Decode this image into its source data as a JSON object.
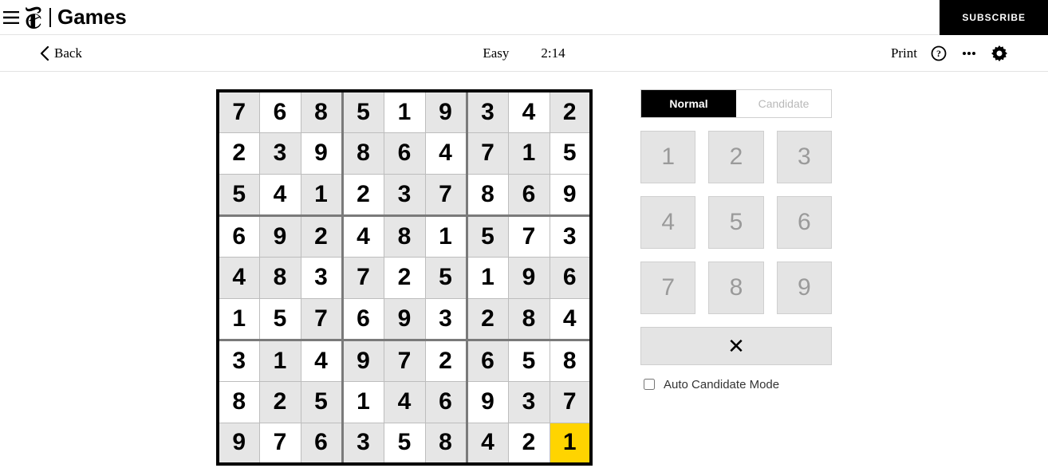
{
  "header": {
    "brand_separator": "|",
    "brand_games": "Games",
    "subscribe": "SUBSCRIBE"
  },
  "subbar": {
    "back": "Back",
    "difficulty": "Easy",
    "timer": "2:14",
    "print": "Print"
  },
  "board": {
    "cells": [
      [
        {
          "v": "7",
          "s": 1
        },
        {
          "v": "6"
        },
        {
          "v": "8",
          "s": 1
        },
        {
          "v": "5",
          "s": 1
        },
        {
          "v": "1"
        },
        {
          "v": "9",
          "s": 1
        },
        {
          "v": "3",
          "s": 1
        },
        {
          "v": "4"
        },
        {
          "v": "2",
          "s": 1
        }
      ],
      [
        {
          "v": "2"
        },
        {
          "v": "3",
          "s": 1
        },
        {
          "v": "9"
        },
        {
          "v": "8",
          "s": 1
        },
        {
          "v": "6",
          "s": 1
        },
        {
          "v": "4"
        },
        {
          "v": "7",
          "s": 1
        },
        {
          "v": "1",
          "s": 1
        },
        {
          "v": "5"
        }
      ],
      [
        {
          "v": "5",
          "s": 1
        },
        {
          "v": "4"
        },
        {
          "v": "1",
          "s": 1
        },
        {
          "v": "2"
        },
        {
          "v": "3",
          "s": 1
        },
        {
          "v": "7",
          "s": 1
        },
        {
          "v": "8"
        },
        {
          "v": "6",
          "s": 1
        },
        {
          "v": "9"
        }
      ],
      [
        {
          "v": "6"
        },
        {
          "v": "9",
          "s": 1
        },
        {
          "v": "2",
          "s": 1
        },
        {
          "v": "4"
        },
        {
          "v": "8",
          "s": 1
        },
        {
          "v": "1"
        },
        {
          "v": "5",
          "s": 1
        },
        {
          "v": "7"
        },
        {
          "v": "3"
        }
      ],
      [
        {
          "v": "4",
          "s": 1
        },
        {
          "v": "8",
          "s": 1
        },
        {
          "v": "3"
        },
        {
          "v": "7",
          "s": 1
        },
        {
          "v": "2"
        },
        {
          "v": "5",
          "s": 1
        },
        {
          "v": "1"
        },
        {
          "v": "9",
          "s": 1
        },
        {
          "v": "6",
          "s": 1
        }
      ],
      [
        {
          "v": "1"
        },
        {
          "v": "5"
        },
        {
          "v": "7",
          "s": 1
        },
        {
          "v": "6"
        },
        {
          "v": "9",
          "s": 1
        },
        {
          "v": "3"
        },
        {
          "v": "2",
          "s": 1
        },
        {
          "v": "8",
          "s": 1
        },
        {
          "v": "4"
        }
      ],
      [
        {
          "v": "3"
        },
        {
          "v": "1",
          "s": 1
        },
        {
          "v": "4"
        },
        {
          "v": "9",
          "s": 1
        },
        {
          "v": "7",
          "s": 1
        },
        {
          "v": "2"
        },
        {
          "v": "6",
          "s": 1
        },
        {
          "v": "5"
        },
        {
          "v": "8"
        }
      ],
      [
        {
          "v": "8"
        },
        {
          "v": "2",
          "s": 1
        },
        {
          "v": "5",
          "s": 1
        },
        {
          "v": "1"
        },
        {
          "v": "4",
          "s": 1
        },
        {
          "v": "6",
          "s": 1
        },
        {
          "v": "9"
        },
        {
          "v": "3",
          "s": 1
        },
        {
          "v": "7",
          "s": 1
        }
      ],
      [
        {
          "v": "9",
          "s": 1
        },
        {
          "v": "7"
        },
        {
          "v": "6",
          "s": 1
        },
        {
          "v": "3",
          "s": 1
        },
        {
          "v": "5"
        },
        {
          "v": "8",
          "s": 1
        },
        {
          "v": "4",
          "s": 1
        },
        {
          "v": "2"
        },
        {
          "v": "1",
          "sel": 1
        }
      ]
    ]
  },
  "panel": {
    "mode_normal": "Normal",
    "mode_candidate": "Candidate",
    "keys": [
      "1",
      "2",
      "3",
      "4",
      "5",
      "6",
      "7",
      "8",
      "9"
    ],
    "erase_glyph": "✕",
    "auto_label": "Auto Candidate Mode",
    "auto_checked": false
  }
}
